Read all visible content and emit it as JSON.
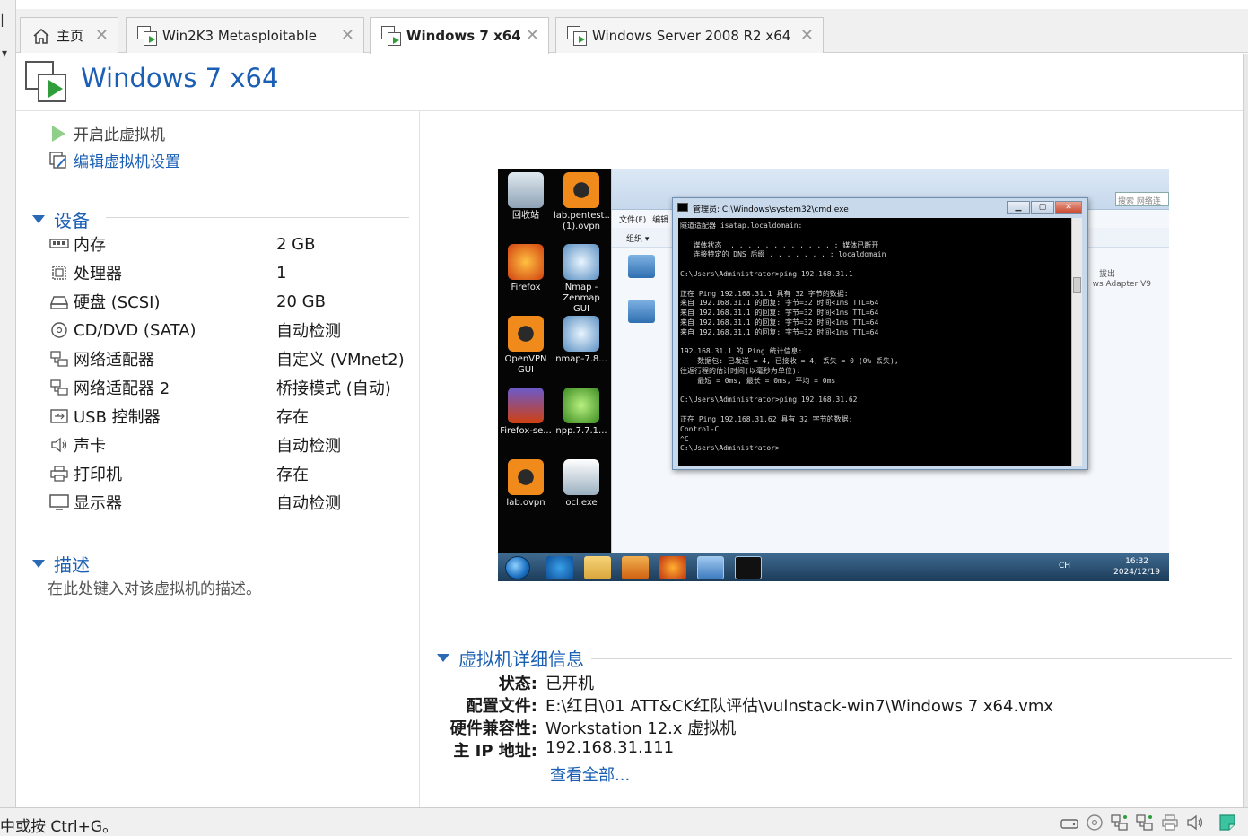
{
  "tabs": [
    {
      "label": "主页",
      "icon": "home-icon",
      "active": false
    },
    {
      "label": "Win2K3 Metasploitable",
      "icon": "vm-icon",
      "active": false
    },
    {
      "label": "Windows 7 x64",
      "icon": "vm-icon",
      "active": true
    },
    {
      "label": "Windows Server 2008 R2 x64",
      "icon": "vm-icon",
      "active": false
    }
  ],
  "header": {
    "title": "Windows 7 x64"
  },
  "actions": {
    "power_on": "开启此虚拟机",
    "edit_settings": "编辑虚拟机设置"
  },
  "devices": {
    "section_title": "设备",
    "items": [
      {
        "name": "内存",
        "value": "2 GB",
        "icon": "memory-icon"
      },
      {
        "name": "处理器",
        "value": "1",
        "icon": "cpu-icon"
      },
      {
        "name": "硬盘 (SCSI)",
        "value": "20 GB",
        "icon": "harddisk-icon"
      },
      {
        "name": "CD/DVD (SATA)",
        "value": "自动检测",
        "icon": "cd-dvd-icon"
      },
      {
        "name": "网络适配器",
        "value": "自定义 (VMnet2)",
        "icon": "network-adapter-icon"
      },
      {
        "name": "网络适配器 2",
        "value": "桥接模式 (自动)",
        "icon": "network-adapter-icon"
      },
      {
        "name": "USB 控制器",
        "value": "存在",
        "icon": "usb-icon"
      },
      {
        "name": "声卡",
        "value": "自动检测",
        "icon": "sound-icon"
      },
      {
        "name": "打印机",
        "value": "存在",
        "icon": "printer-icon"
      },
      {
        "name": "显示器",
        "value": "自动检测",
        "icon": "display-icon"
      }
    ]
  },
  "description": {
    "section_title": "描述",
    "placeholder": "在此处键入对该虚拟机的描述。"
  },
  "vm_screen": {
    "desktop_icons": [
      {
        "label": "回收站",
        "icon": "recycle-bin-icon"
      },
      {
        "label": "lab.pentest...(1).ovpn",
        "icon": "openvpn-icon"
      },
      {
        "label": "Firefox",
        "icon": "firefox-icon"
      },
      {
        "label": "Nmap - Zenmap GUI",
        "icon": "nmap-icon"
      },
      {
        "label": "OpenVPN GUI",
        "icon": "openvpn-icon"
      },
      {
        "label": "nmap-7.8...",
        "icon": "nmap-icon"
      },
      {
        "label": "Firefox-se...",
        "icon": "firefox-setup-icon"
      },
      {
        "label": "npp.7.7.1...",
        "icon": "notepadpp-icon"
      },
      {
        "label": "lab.ovpn",
        "icon": "openvpn-icon"
      },
      {
        "label": "ocl.exe",
        "icon": "exe-icon"
      }
    ],
    "explorer": {
      "menu_file": "文件(F)",
      "menu_edit": "编辑",
      "organize": "组织 ▾",
      "search_placeholder": "搜索 网络连",
      "adapter_text": "ws Adapter V9",
      "disconnect_text": "拔出"
    },
    "cmd": {
      "title": "管理员: C:\\Windows\\system32\\cmd.exe",
      "lines": [
        "隧道适配器 isatap.localdomain:",
        "",
        "   媒体状态  . . . . . . . . . . . . : 媒体已断开",
        "   连接特定的 DNS 后缀 . . . . . . . : localdomain",
        "",
        "C:\\Users\\Administrator>ping 192.168.31.1",
        "",
        "正在 Ping 192.168.31.1 具有 32 字节的数据:",
        "来自 192.168.31.1 的回复: 字节=32 时间<1ms TTL=64",
        "来自 192.168.31.1 的回复: 字节=32 时间<1ms TTL=64",
        "来自 192.168.31.1 的回复: 字节=32 时间<1ms TTL=64",
        "来自 192.168.31.1 的回复: 字节=32 时间<1ms TTL=64",
        "",
        "192.168.31.1 的 Ping 统计信息:",
        "    数据包: 已发送 = 4, 已接收 = 4, 丢失 = 0 (0% 丢失),",
        "往返行程的估计时间(以毫秒为单位):",
        "    最短 = 0ms, 最长 = 0ms, 平均 = 0ms",
        "",
        "C:\\Users\\Administrator>ping 192.168.31.62",
        "",
        "正在 Ping 192.168.31.62 具有 32 字节的数据:",
        "Control-C",
        "^C",
        "C:\\Users\\Administrator>"
      ]
    },
    "taskbar": {
      "tray_text": "CH",
      "time": "16:32",
      "date": "2024/12/19"
    }
  },
  "details": {
    "section_title": "虚拟机详细信息",
    "rows": [
      {
        "key": "状态:",
        "value": "已开机"
      },
      {
        "key": "配置文件:",
        "value": "E:\\红日\\01 ATT&CK红队评估\\vulnstack-win7\\Windows 7 x64.vmx"
      },
      {
        "key": "硬件兼容性:",
        "value": "Workstation 12.x 虚拟机"
      },
      {
        "key": "主 IP 地址:",
        "value": "192.168.31.111"
      }
    ],
    "see_all": "查看全部..."
  },
  "statusbar": {
    "text": "中或按 Ctrl+G。"
  },
  "colors": {
    "accent": "#1a5fb4",
    "play_green": "#2f9e3a"
  }
}
